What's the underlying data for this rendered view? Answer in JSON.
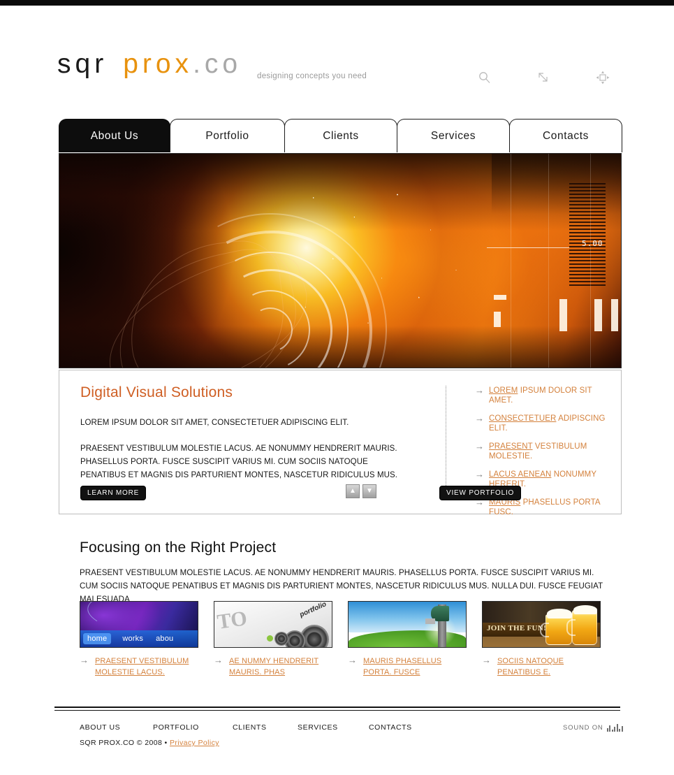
{
  "brand": {
    "logo_part1": "sqr",
    "logo_part2": "prox",
    "logo_part3": ".co",
    "tagline": "designing concepts you need"
  },
  "header": {
    "icons": [
      {
        "name": "search-icon",
        "label": "search"
      },
      {
        "name": "resize-icon",
        "label": "resize"
      },
      {
        "name": "move-icon",
        "label": "move"
      }
    ]
  },
  "nav": {
    "tabs": [
      {
        "label": "About Us",
        "active": true
      },
      {
        "label": "Portfolio",
        "active": false
      },
      {
        "label": "Clients",
        "active": false
      },
      {
        "label": "Services",
        "active": false
      },
      {
        "label": "Contacts",
        "active": false
      }
    ]
  },
  "hero": {
    "alt": "abstract orange and yellow digital energy burst with HUD graphics",
    "readout": "5.00"
  },
  "intro": {
    "title": "Digital Visual Solutions",
    "paragraph1": "LOREM IPSUM DOLOR SIT AMET, CONSECTETUER ADIPISCING ELIT.",
    "paragraph2": "PRAESENT VESTIBULUM MOLESTIE LACUS. AE NONUMMY HENDRERIT MAURIS. PHASELLUS PORTA. FUSCE SUSCIPIT VARIUS MI. CUM SOCIIS NATOQUE PENATIBUS ET MAGNIS DIS PARTURIENT MONTES, NASCETUR RIDICULUS MUS.",
    "learn_more": "LEARN MORE",
    "view_portfolio": "VIEW PORTFOLIO",
    "scroll_up": "▲",
    "scroll_down": "▼",
    "links": [
      {
        "bullet": "→",
        "linked": "LOREM",
        "rest": " IPSUM DOLOR SIT AMET."
      },
      {
        "bullet": "→",
        "linked": "CONSECTETUER",
        "rest": " ADIPISCING ELIT."
      },
      {
        "bullet": "→",
        "linked": "PRAESENT",
        "rest": " VESTIBULUM MOLESTIE."
      },
      {
        "bullet": "→",
        "linked": "LACUS AENEAN",
        "rest": " NONUMMY HERERIT."
      },
      {
        "bullet": "→",
        "linked": "MAURIS",
        "rest": " PHASELLUS PORTA FUSC."
      }
    ]
  },
  "focus": {
    "title": "Focusing on the Right Project",
    "paragraph": "PRAESENT VESTIBULUM MOLESTIE LACUS. AE NONUMMY HENDRERIT MAURIS. PHASELLUS PORTA. FUSCE SUSCIPIT VARIUS MI. CUM SOCIIS NATOQUE PENATIBUS ET MAGNIS DIS PARTURIENT MONTES, NASCETUR RIDICULUS MUS. NULLA DUI. FUSCE FEUGIAT MALESUADA"
  },
  "cards": [
    {
      "bullet": "→",
      "caption": "PRAESENT VESTIBULUM MOLESTIE LACUS.",
      "thumb_alt": "purple blue website with home works about navigation",
      "nav": {
        "home": "home",
        "works": "works",
        "about": "abou"
      }
    },
    {
      "bullet": "→",
      "caption": "AE NUMMY HENDRERIT MAURIS. PHAS",
      "thumb_alt": "white portfolio layout with speaker cones",
      "to_text": "TO",
      "portfolio_text": "portfolio"
    },
    {
      "bullet": "→",
      "caption": "MAURIS PHASELLUS PORTA. FUSCE",
      "thumb_alt": "green field under blue sky with mailbox"
    },
    {
      "bullet": "→",
      "caption": "SOCIIS NATOQUE PENATIBUS E.",
      "thumb_alt": "join the fun beer mugs banner",
      "banner_text": "JOIN THE FUN!"
    }
  ],
  "footer": {
    "links": [
      "ABOUT US",
      "PORTFOLIO",
      "CLIENTS",
      "SERVICES",
      "CONTACTS"
    ],
    "copyright": "SQR PROX.CO © 2008 • ",
    "privacy": "Privacy Policy",
    "sound_label": "SOUND ON"
  },
  "colors": {
    "accent_orange": "#d4813c",
    "heading_orange": "#cf5f24",
    "logo_orange": "#e8920e",
    "black": "#0d0d0d"
  }
}
